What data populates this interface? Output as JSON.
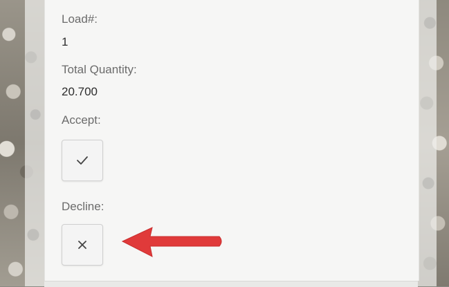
{
  "load": {
    "label": "Load#:",
    "value": "1"
  },
  "total_quantity": {
    "label": "Total Quantity:",
    "value": "20.700"
  },
  "accept": {
    "label": "Accept:",
    "icon": "checkmark-icon"
  },
  "decline": {
    "label": "Decline:",
    "icon": "x-close-icon"
  },
  "annotation": {
    "icon": "red-arrow-icon",
    "color": "#e03a3a"
  },
  "colors": {
    "card_background": "#f6f6f5",
    "label_text": "#6b6b6b",
    "value_text": "#2c2c2c"
  }
}
